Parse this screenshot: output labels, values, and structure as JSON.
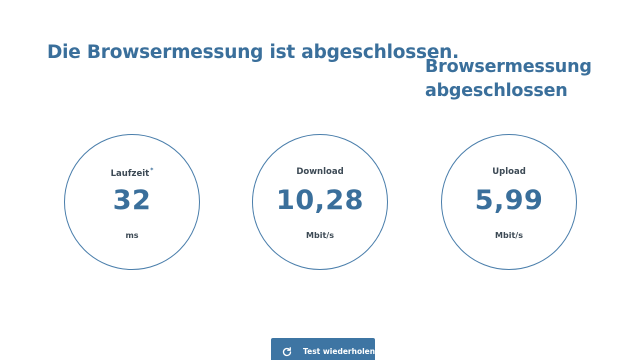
{
  "header": {
    "title": "Die Browsermessung ist abgeschlossen.",
    "side_title": "Browsermessung abgeschlossen"
  },
  "results": [
    {
      "label": "Laufzeit",
      "footnote_mark": "*",
      "value": "32",
      "unit": "ms"
    },
    {
      "label": "Download",
      "footnote_mark": "",
      "value": "10,28",
      "unit": "Mbit/s"
    },
    {
      "label": "Upload",
      "footnote_mark": "",
      "value": "5,99",
      "unit": "Mbit/s"
    }
  ],
  "actions": {
    "retest_label": "Test wiederholen",
    "retest_icon": "refresh-icon"
  },
  "colors": {
    "accent": "#3a6f9b",
    "button": "#3e75a3",
    "gauge_border": "#4a7eab"
  }
}
